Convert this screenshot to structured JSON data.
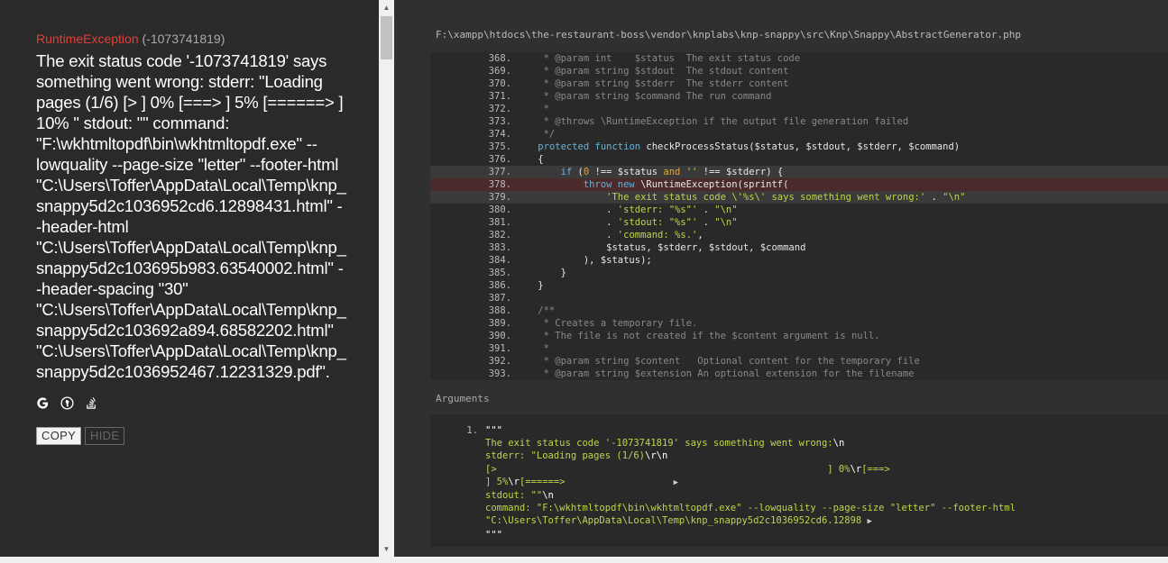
{
  "exception": {
    "class": "RuntimeException",
    "code": "(-1073741819)",
    "message": "The exit status code '-1073741819' says something went wrong: stderr: \"Loading pages (1/6) [> ] 0% [===> ] 5% [======> ] 10% \" stdout: \"\" command: \"F:\\wkhtmltopdf\\bin\\wkhtmltopdf.exe\" --lowquality --page-size \"letter\" --footer-html \"C:\\Users\\Toffer\\AppData\\Local\\Temp\\knp_snappy5d2c1036952cd6.12898431.html\" --header-html \"C:\\Users\\Toffer\\AppData\\Local\\Temp\\knp_snappy5d2c103695b983.63540002.html\" --header-spacing \"30\" \"C:\\Users\\Toffer\\AppData\\Local\\Temp\\knp_snappy5d2c103692a894.68582202.html\" \"C:\\Users\\Toffer\\AppData\\Local\\Temp\\knp_snappy5d2c1036952467.12231329.pdf\"."
  },
  "search_links": [
    {
      "name": "google-search-icon",
      "icon": "google"
    },
    {
      "name": "duckduckgo-search-icon",
      "icon": "duckduckgo"
    },
    {
      "name": "stackoverflow-search-icon",
      "icon": "stackoverflow"
    }
  ],
  "buttons": {
    "copy": "COPY",
    "hide": "HIDE"
  },
  "scrollbar": {
    "up": "▲",
    "down": "▼"
  },
  "file_path": "F:\\xampp\\htdocs\\the-restaurant-boss\\vendor\\knplabs\\knp-snappy\\src\\Knp\\Snappy\\AbstractGenerator.php",
  "arguments_title": "Arguments",
  "code_lines": [
    {
      "num": "368.",
      "tokens": [
        [
          "c-comment",
          "     * @param int    $status  The exit status code"
        ]
      ]
    },
    {
      "num": "369.",
      "tokens": [
        [
          "c-comment",
          "     * @param string $stdout  The stdout content"
        ]
      ]
    },
    {
      "num": "370.",
      "tokens": [
        [
          "c-comment",
          "     * @param string $stderr  The stderr content"
        ]
      ]
    },
    {
      "num": "371.",
      "tokens": [
        [
          "c-comment",
          "     * @param string $command The run command"
        ]
      ]
    },
    {
      "num": "372.",
      "tokens": [
        [
          "c-comment",
          "     *"
        ]
      ]
    },
    {
      "num": "373.",
      "tokens": [
        [
          "c-comment",
          "     * @throws \\RuntimeException if the output file generation failed"
        ]
      ]
    },
    {
      "num": "374.",
      "tokens": [
        [
          "c-comment",
          "     */"
        ]
      ]
    },
    {
      "num": "375.",
      "tokens": [
        [
          "c-plain",
          "    "
        ],
        [
          "c-kw",
          "protected function "
        ],
        [
          "c-plain",
          "checkProcessStatus($status, $stdout, $stderr, $command)"
        ]
      ]
    },
    {
      "num": "376.",
      "tokens": [
        [
          "c-plain",
          "    {"
        ]
      ]
    },
    {
      "num": "377.",
      "hl": "hl",
      "tokens": [
        [
          "c-plain",
          "        "
        ],
        [
          "c-kw",
          "if "
        ],
        [
          "c-plain",
          "("
        ],
        [
          "c-num",
          "0"
        ],
        [
          "c-plain",
          " !== $status "
        ],
        [
          "c-op",
          "and "
        ],
        [
          "c-str",
          "''"
        ],
        [
          "c-plain",
          " !== $stderr) {"
        ]
      ]
    },
    {
      "num": "378.",
      "hl": "hl-err",
      "tokens": [
        [
          "c-plain",
          "            "
        ],
        [
          "c-kw",
          "throw new "
        ],
        [
          "c-plain",
          "\\RuntimeException(sprintf("
        ]
      ]
    },
    {
      "num": "379.",
      "hl": "hl",
      "tokens": [
        [
          "c-plain",
          "                "
        ],
        [
          "c-str",
          "'The exit status code \\'%s\\' says something went wrong:'"
        ],
        [
          "c-plain",
          " . "
        ],
        [
          "c-str",
          "\"\\n\""
        ]
      ]
    },
    {
      "num": "380.",
      "tokens": [
        [
          "c-plain",
          "                . "
        ],
        [
          "c-str",
          "'stderr: \"%s\"'"
        ],
        [
          "c-plain",
          " . "
        ],
        [
          "c-str",
          "\"\\n\""
        ]
      ]
    },
    {
      "num": "381.",
      "tokens": [
        [
          "c-plain",
          "                . "
        ],
        [
          "c-str",
          "'stdout: \"%s\"'"
        ],
        [
          "c-plain",
          " . "
        ],
        [
          "c-str",
          "\"\\n\""
        ]
      ]
    },
    {
      "num": "382.",
      "tokens": [
        [
          "c-plain",
          "                . "
        ],
        [
          "c-str",
          "'command: %s.'"
        ],
        [
          "c-plain",
          ","
        ]
      ]
    },
    {
      "num": "383.",
      "tokens": [
        [
          "c-plain",
          "                $status, $stderr, $stdout, $command"
        ]
      ]
    },
    {
      "num": "384.",
      "tokens": [
        [
          "c-plain",
          "            ), $status);"
        ]
      ]
    },
    {
      "num": "385.",
      "tokens": [
        [
          "c-plain",
          "        }"
        ]
      ]
    },
    {
      "num": "386.",
      "tokens": [
        [
          "c-plain",
          "    }"
        ]
      ]
    },
    {
      "num": "387.",
      "tokens": [
        [
          "c-plain",
          ""
        ]
      ]
    },
    {
      "num": "388.",
      "tokens": [
        [
          "c-comment",
          "    /**"
        ]
      ]
    },
    {
      "num": "389.",
      "tokens": [
        [
          "c-comment",
          "     * Creates a temporary file."
        ]
      ]
    },
    {
      "num": "390.",
      "tokens": [
        [
          "c-comment",
          "     * The file is not created if the $content argument is null."
        ]
      ]
    },
    {
      "num": "391.",
      "tokens": [
        [
          "c-comment",
          "     *"
        ]
      ]
    },
    {
      "num": "392.",
      "tokens": [
        [
          "c-comment",
          "     * @param string $content   Optional content for the temporary file"
        ]
      ]
    },
    {
      "num": "393.",
      "tokens": [
        [
          "c-comment",
          "     * @param string $extension An optional extension for the filename"
        ]
      ]
    }
  ],
  "arguments": [
    {
      "idx": "1.",
      "lines": [
        [
          [
            "a-white",
            "\"\"\""
          ]
        ],
        [
          [
            "a-str",
            "The exit status code '-1073741819' says something went wrong:"
          ],
          [
            "a-white",
            "\\n"
          ]
        ],
        [
          [
            "a-str",
            "stderr: \"Loading pages (1/6)"
          ],
          [
            "a-white",
            "\\r\\n"
          ]
        ],
        [
          [
            "a-str",
            "[>                                                          ] 0%"
          ],
          [
            "a-white",
            "\\r"
          ],
          [
            "a-str",
            "[===>"
          ]
        ],
        [
          [
            "a-str",
            "] 5%"
          ],
          [
            "a-white",
            "\\r"
          ],
          [
            "a-str",
            "[======>                   "
          ],
          [
            "a-toggle",
            "▶"
          ]
        ],
        [
          [
            "a-str",
            "stdout: \"\""
          ],
          [
            "a-white",
            "\\n"
          ]
        ],
        [
          [
            "a-str",
            "command: \"F:\\wkhtmltopdf\\bin\\wkhtmltopdf.exe\" --lowquality --page-size \"letter\" --footer-html"
          ]
        ],
        [
          [
            "a-str",
            "\"C:\\Users\\Toffer\\AppData\\Local\\Temp\\knp_snappy5d2c1036952cd6.12898 "
          ],
          [
            "a-toggle",
            "▶"
          ]
        ],
        [
          [
            "a-white",
            "\"\"\""
          ]
        ]
      ]
    }
  ]
}
